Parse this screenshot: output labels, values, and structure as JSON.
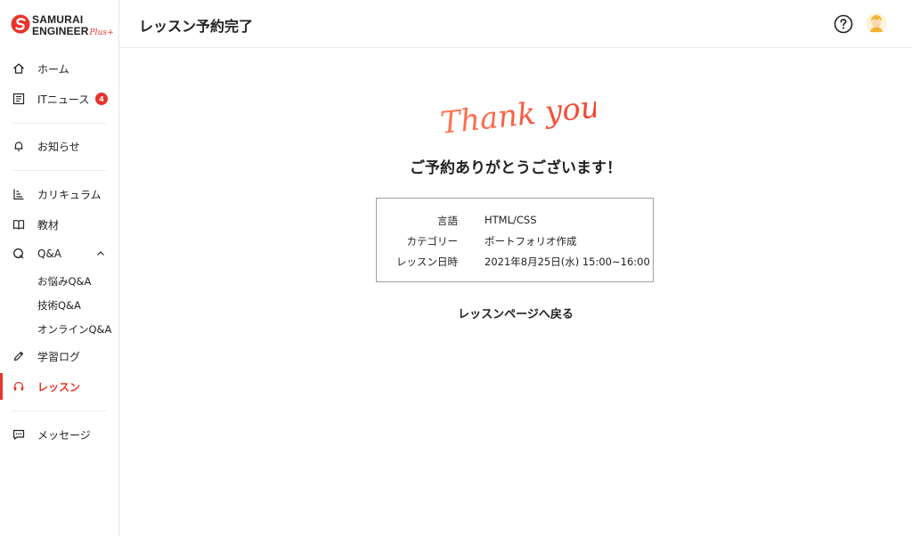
{
  "brand": {
    "line1": "SAMURAI",
    "line2": "ENGINEER",
    "plus": "Plus+",
    "accent": "#e8342b"
  },
  "sidebar": {
    "items": [
      {
        "label": "ホーム",
        "icon": "home-icon"
      },
      {
        "label": "ITニュース",
        "icon": "news-icon",
        "badge": "4"
      },
      {
        "label": "お知らせ",
        "icon": "bell-icon"
      },
      {
        "label": "カリキュラム",
        "icon": "curriculum-icon"
      },
      {
        "label": "教材",
        "icon": "book-icon"
      },
      {
        "label": "Q&A",
        "icon": "qa-icon",
        "expanded": true
      },
      {
        "label": "学習ログ",
        "icon": "pencil-icon"
      },
      {
        "label": "レッスン",
        "icon": "headset-icon",
        "active": true
      },
      {
        "label": "メッセージ",
        "icon": "chat-icon"
      }
    ],
    "qa_sub": [
      "お悩みQ&A",
      "技術Q&A",
      "オンラインQ&A"
    ]
  },
  "header": {
    "title": "レッスン予約完了",
    "help_icon": "help-icon",
    "avatar_icon": "avatar-icon"
  },
  "main": {
    "thanks": "Thank you!!",
    "headline": "ご予約ありがとうございます！",
    "details": [
      {
        "key": "言語",
        "value": "HTML/CSS"
      },
      {
        "key": "カテゴリー",
        "value": "ポートフォリオ作成"
      },
      {
        "key": "レッスン日時",
        "value": "2021年8月25日(水) 15:00~16:00"
      }
    ],
    "back_link": "レッスンページへ戻る"
  }
}
